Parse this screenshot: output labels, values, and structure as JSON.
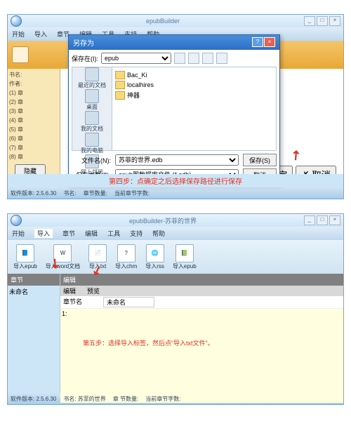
{
  "win1": {
    "app_title": "epubBuilder",
    "menubar": [
      "开始",
      "导入",
      "章节",
      "编辑",
      "工具",
      "支持",
      "帮助"
    ],
    "left_rows": [
      "书名:",
      "作者:",
      "",
      "(1) 章",
      "(2) 章",
      "(3) 章",
      "(4) 章",
      "(5) 章",
      "(6) 章",
      "(7) 章",
      "(8) 章"
    ],
    "dialog": {
      "title": "另存为",
      "savein_label": "保存在(I):",
      "savein_value": "epub",
      "places": [
        "最近的文档",
        "桌面",
        "我的文档",
        "我的电脑",
        "网上邻居"
      ],
      "files": [
        "Bac_Ki",
        "localhires",
        "神器"
      ],
      "filename_label": "文件名(N):",
      "filename_value": "苏菲的世界.edb",
      "filetype_label": "保存类型(T):",
      "filetype_value": "epub图数据库文件 (*.edb)",
      "save_btn": "保存(S)",
      "cancel_btn": "取消"
    },
    "foot_hide": "隐藏(H)",
    "foot_ok": "✓ 确定",
    "foot_cancel": "✗ 取消",
    "annotation": "第四步：点确定之后选择保存路径进行保存",
    "status": {
      "ver": "软件版本: 2.5.6.30",
      "book": "书名:",
      "count": "章节数量:",
      "curr": "当前章节字数:"
    }
  },
  "win2": {
    "app_title": "epubBuilder-苏菲的世界",
    "menubar": [
      "开始",
      "导入",
      "章节",
      "编辑",
      "工具",
      "支持",
      "帮助"
    ],
    "ribbon": [
      "导入epub",
      "导入word文档",
      "导入txt",
      "导入chm",
      "导入rss",
      "导入epub"
    ],
    "left_hdr": "章节",
    "left_item": "未命名",
    "right_hdr": "编辑",
    "sub_labels": [
      "编辑",
      "预览"
    ],
    "chapter_label": "章节名",
    "chapter_value": "未命名",
    "line1": "1:",
    "annotation": "第五步：选择导入标签，然后点“导入txt文件”。",
    "status": {
      "ver": "软件版本: 2.5.6.30",
      "book": "书名: 苏菲的世界",
      "count": "章 节数量:",
      "curr": "当前章节字数:"
    }
  }
}
